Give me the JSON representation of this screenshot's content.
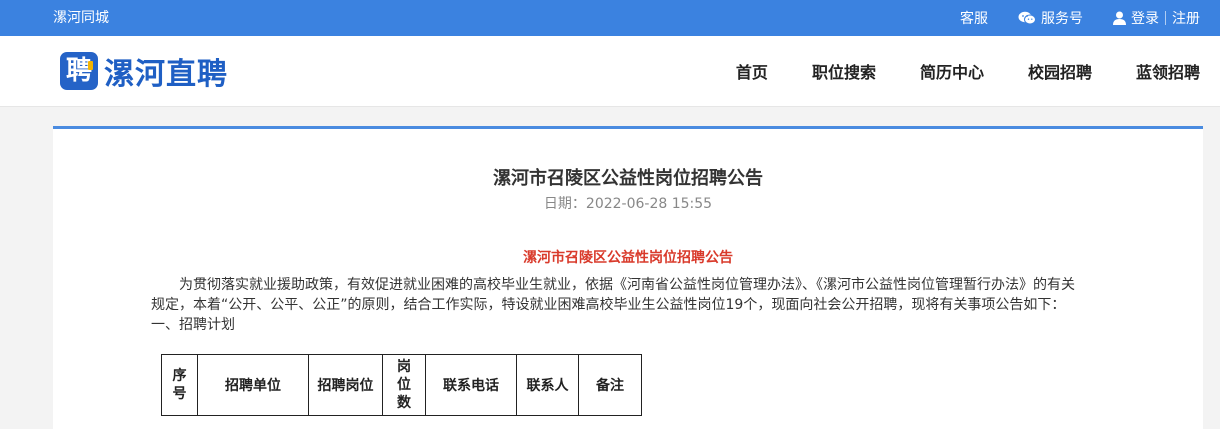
{
  "topbar": {
    "city": "漯河同城",
    "service": "客服",
    "wechat": "服务号",
    "login": "登录",
    "register": "注册"
  },
  "header": {
    "logo_char": "聘",
    "logo_text": "漯河直聘",
    "nav": [
      "首页",
      "职位搜索",
      "简历中心",
      "校园招聘",
      "蓝领招聘"
    ]
  },
  "article": {
    "title": "漯河市召陵区公益性岗位招聘公告",
    "date": "日期：2022-06-28 15:55",
    "subtitle": "漯河市召陵区公益性岗位招聘公告",
    "paragraph1": "为贯彻落实就业援助政策，有效促进就业困难的高校毕业生就业，依据《河南省公益性岗位管理办法》、《漯河市公益性岗位管理暂行办法》的有关",
    "paragraph1_cont": "规定，本着“公开、公平、公正”的原则，结合工作实际，特设就业困难高校毕业生公益性岗位19个，现面向社会公开招聘，现将有关事项公告如下：",
    "section1": "一、招聘计划"
  },
  "table": {
    "headers": [
      "序号",
      "招聘单位",
      "招聘岗位",
      "岗位数",
      "联系电话",
      "联系人",
      "备注"
    ]
  },
  "colors": {
    "topbar": "#3b82e0",
    "accent": "#1f5fc4",
    "subtitle_red": "#d93a2b"
  }
}
